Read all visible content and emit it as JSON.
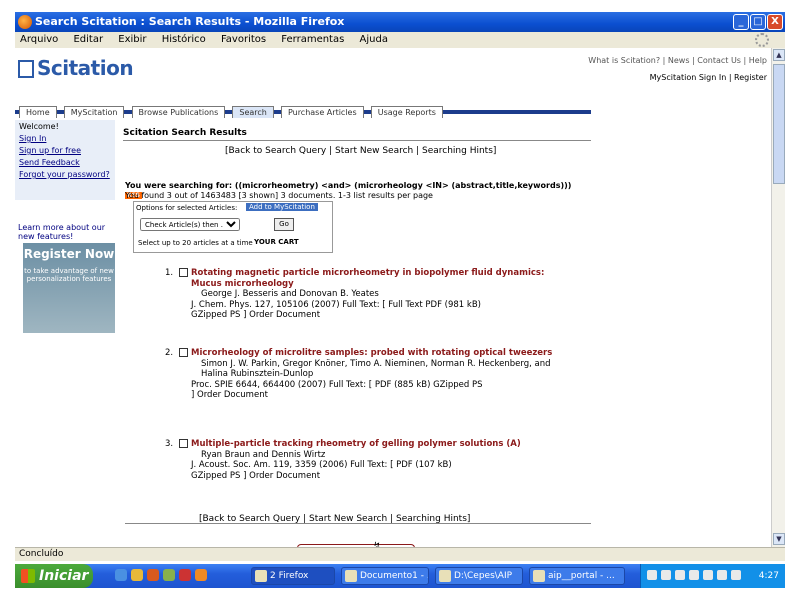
{
  "window": {
    "title": "Search Scitation : Search Results - Mozilla Firefox",
    "min_glyph": "_",
    "max_glyph": "□",
    "close_glyph": "X"
  },
  "menubar": [
    "Arquivo",
    "Editar",
    "Exibir",
    "Histórico",
    "Favoritos",
    "Ferramentas",
    "Ajuda"
  ],
  "site": {
    "logo": "Scitation",
    "top_links": "What is Scitation? | News | Contact Us | Help",
    "user_links": "MyScitation Sign In | Register",
    "tabs": [
      "Home",
      "MyScitation",
      "Browse Publications",
      "Search",
      "Purchase Articles",
      "Usage Reports"
    ],
    "selected_tab": "Search"
  },
  "leftnav": {
    "welcome": "Welcome!",
    "links": [
      "Sign In",
      "Sign up for free",
      "Send Feedback",
      "Forgot your password?"
    ],
    "learn_more": "Learn more about our new features!",
    "register": {
      "title": "Register Now",
      "text": "to take advantage of new personalization features"
    }
  },
  "results_page": {
    "heading": "Scitation Search Results",
    "top_links": "[Back to Search Query | Start New Search | Searching Hints]",
    "searching_for": "You were searching for: ((microrheometry) <and> (microrheology <IN> (abstract,title,keywords)))",
    "rss": "RSS",
    "found": "You found 3 out of 1463483 [3 shown] 3 documents. 1-3 list results per page",
    "options_label": "Options for selected Articles:",
    "my_cart_label": "Add to MyScitation",
    "select_option": "Check Article(s) then ...",
    "go_button": "Go",
    "select_hint": "Select up to 20 articles at a time",
    "cart": "YOUR CART",
    "bottom_links": "[Back to Search Query | Start New Search | Searching Hints]"
  },
  "results": [
    {
      "num": "1.",
      "title": "Rotating magnetic particle microrheometry in biopolymer fluid dynamics: Mucus microrheology",
      "authors": "George J. Besseris and Donovan B. Yeates",
      "citation": "J. Chem. Phys. 127, 105106 (2007) Full Text: [ Full Text PDF (981 kB)",
      "links": "GZipped PS ] Order Document"
    },
    {
      "num": "2.",
      "title": "Microrheology of microlitre samples: probed with rotating optical tweezers",
      "authors": "Simon J. W. Parkin, Gregor Knöner, Timo A. Nieminen, Norman R. Heckenberg, and Halina Rubinsztein-Dunlop",
      "citation": "Proc. SPIE 6644, 664400 (2007) Full Text: [ PDF (885 kB) GZipped PS",
      "links": "] Order Document"
    },
    {
      "num": "3.",
      "title": "Multiple-particle tracking rheometry of gelling polymer solutions (A)",
      "authors": "Ryan Braun and Dennis Wirtz",
      "citation": "J. Acoust. Soc. Am. 119, 3359 (2006) Full Text: [ PDF (107 kB)",
      "links": "GZipped PS ] Order Document"
    }
  ],
  "statusbar": "Concluído",
  "taskbar": {
    "start": "Iniciar",
    "tasks": [
      "2 Firefox",
      "Documento1 - ...",
      "D:\\Cepes\\AIP",
      "aip__portal - ..."
    ],
    "clock": "4:27"
  }
}
